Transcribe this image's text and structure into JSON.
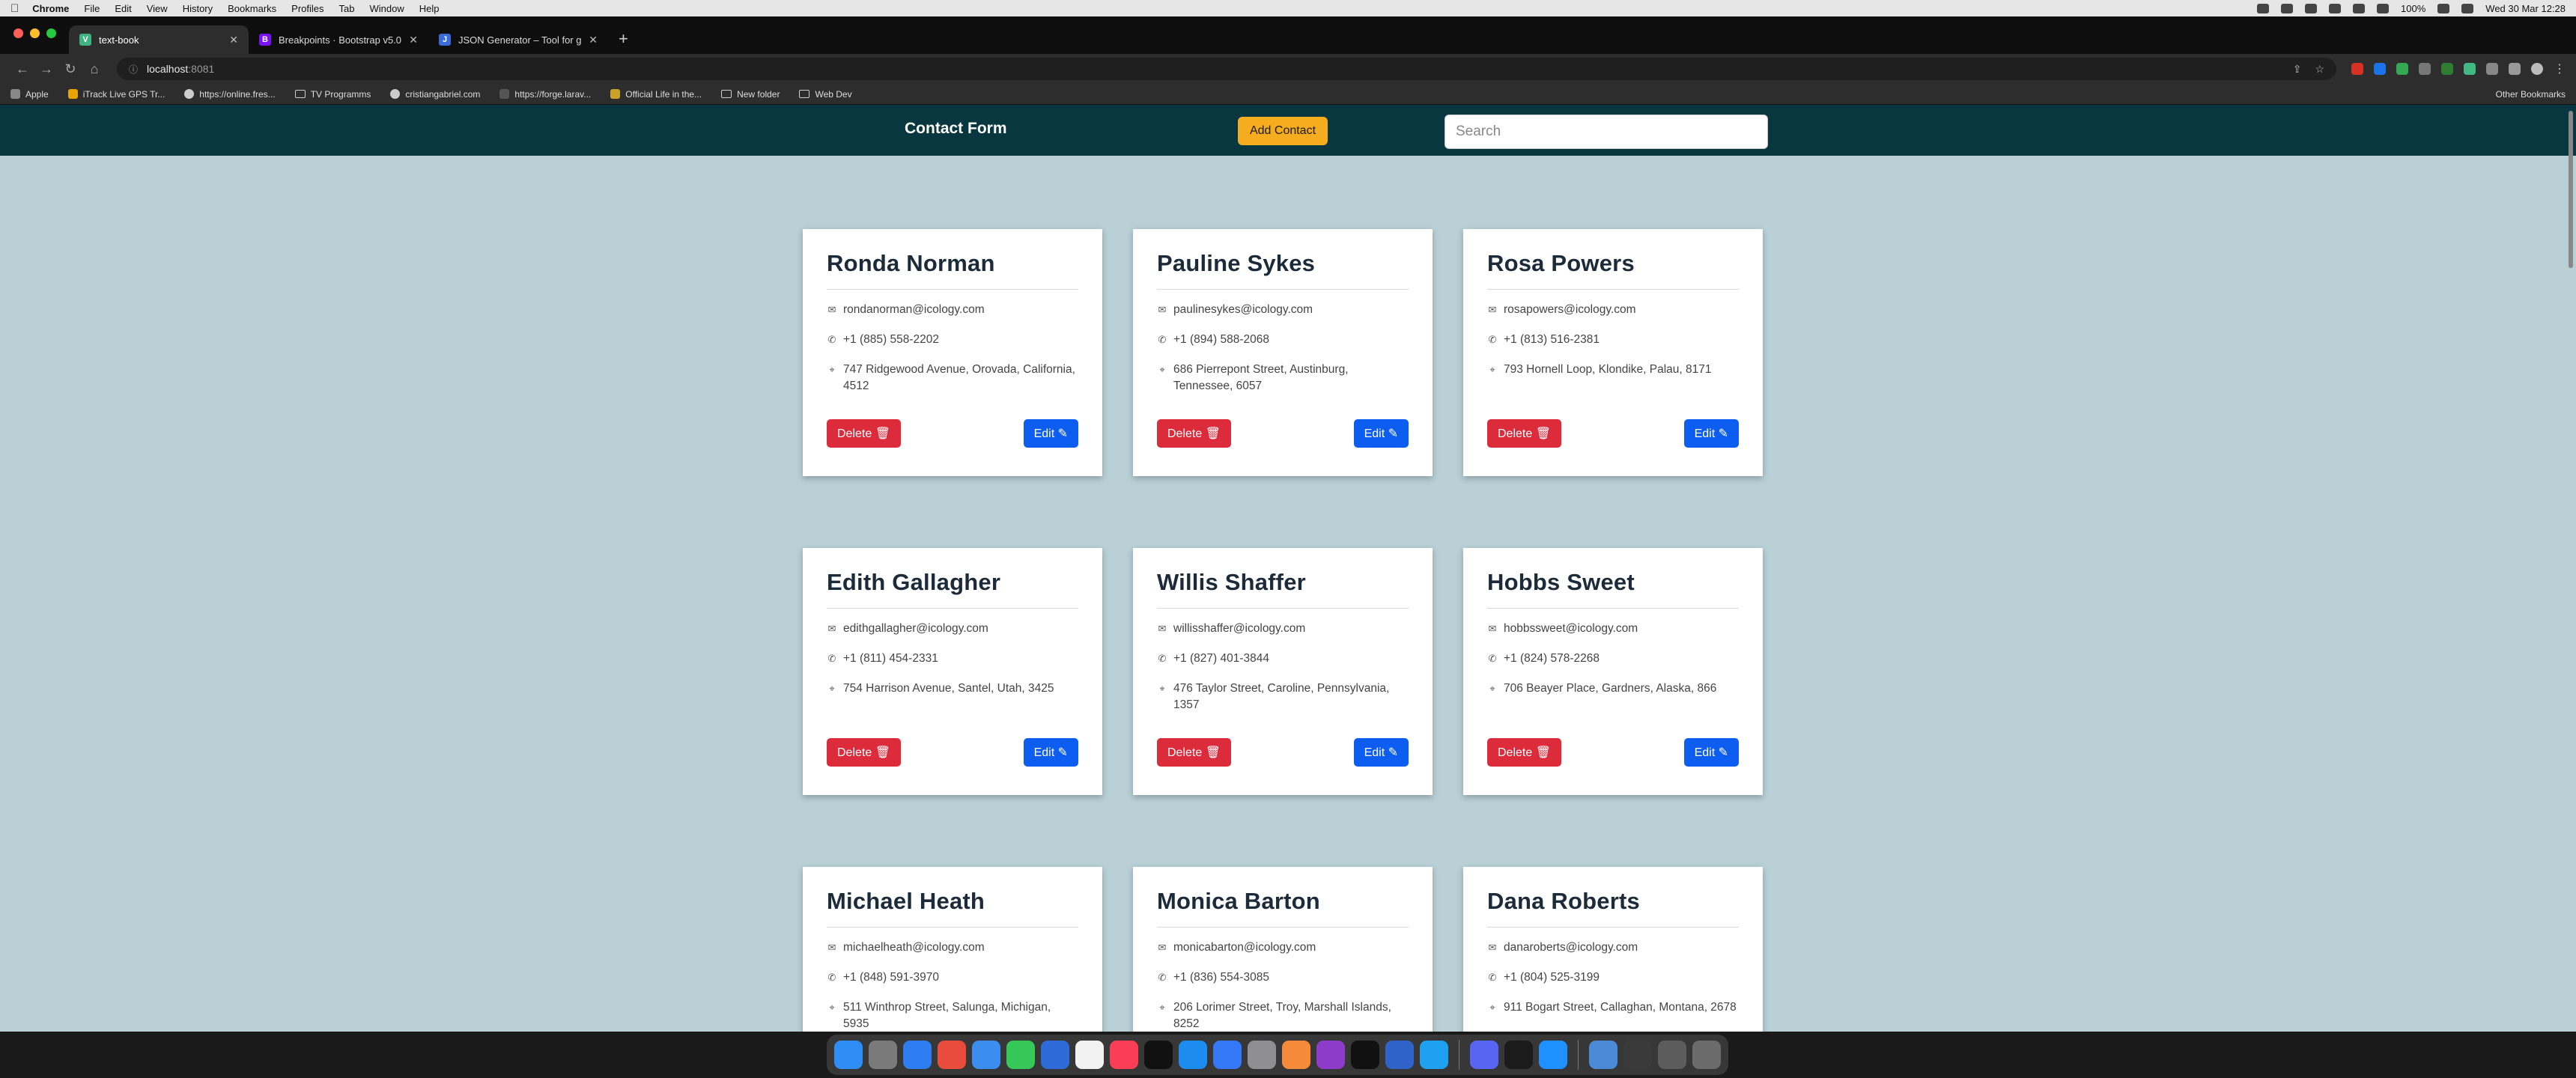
{
  "menubar": {
    "app": "Chrome",
    "items": [
      "File",
      "Edit",
      "View",
      "History",
      "Bookmarks",
      "Profiles",
      "Tab",
      "Window",
      "Help"
    ],
    "battery": "100%",
    "clock": "Wed 30 Mar  12:28"
  },
  "tabs": [
    {
      "title": "text-book",
      "favicon": "V",
      "color": "#3fb27f"
    },
    {
      "title": "Breakpoints · Bootstrap v5.0",
      "favicon": "B",
      "color": "#7a13f1"
    },
    {
      "title": "JSON Generator – Tool for gen",
      "favicon": "J",
      "color": "#3a6bd6"
    }
  ],
  "address": {
    "host": "localhost",
    "port": ":8081"
  },
  "bookmarks": [
    {
      "label": "Apple",
      "icon": "apple-icon"
    },
    {
      "label": "iTrack Live GPS Tr...",
      "icon": "bookmark-icon"
    },
    {
      "label": "https://online.fres...",
      "icon": "globe-icon"
    },
    {
      "label": "TV Programms",
      "icon": "folder-icon"
    },
    {
      "label": "cristiangabriel.com",
      "icon": "globe-icon"
    },
    {
      "label": "https://forge.larav...",
      "icon": "bookmark-icon"
    },
    {
      "label": "Official Life in the...",
      "icon": "bookmark-icon"
    },
    {
      "label": "New folder",
      "icon": "folder-icon"
    },
    {
      "label": "Web Dev",
      "icon": "folder-icon"
    }
  ],
  "bookmarks_right": "Other Bookmarks",
  "app": {
    "brand": "Contact Form",
    "add_label": "Add Contact",
    "search_placeholder": "Search",
    "delete_label": "Delete",
    "edit_label": "Edit"
  },
  "contacts": [
    {
      "name": "Ronda Norman",
      "email": "rondanorman@icology.com",
      "phone": "+1 (885) 558-2202",
      "address": "747 Ridgewood Avenue, Orovada, California, 4512"
    },
    {
      "name": "Pauline Sykes",
      "email": "paulinesykes@icology.com",
      "phone": "+1 (894) 588-2068",
      "address": "686 Pierrepont Street, Austinburg, Tennessee, 6057"
    },
    {
      "name": "Rosa Powers",
      "email": "rosapowers@icology.com",
      "phone": "+1 (813) 516-2381",
      "address": "793 Hornell Loop, Klondike, Palau, 8171"
    },
    {
      "name": "Edith Gallagher",
      "email": "edithgallagher@icology.com",
      "phone": "+1 (811) 454-2331",
      "address": "754 Harrison Avenue, Santel, Utah, 3425"
    },
    {
      "name": "Willis Shaffer",
      "email": "willisshaffer@icology.com",
      "phone": "+1 (827) 401-3844",
      "address": "476 Taylor Street, Caroline, Pennsylvania, 1357"
    },
    {
      "name": "Hobbs Sweet",
      "email": "hobbssweet@icology.com",
      "phone": "+1 (824) 578-2268",
      "address": "706 Beayer Place, Gardners, Alaska, 866"
    },
    {
      "name": "Michael Heath",
      "email": "michaelheath@icology.com",
      "phone": "+1 (848) 591-3970",
      "address": "511 Winthrop Street, Salunga, Michigan, 5935"
    },
    {
      "name": "Monica Barton",
      "email": "monicabarton@icology.com",
      "phone": "+1 (836) 554-3085",
      "address": "206 Lorimer Street, Troy, Marshall Islands, 8252"
    },
    {
      "name": "Dana Roberts",
      "email": "danaroberts@icology.com",
      "phone": "+1 (804) 525-3199",
      "address": "911 Bogart Street, Callaghan, Montana, 2678"
    }
  ],
  "dock_colors": [
    "#2f8ef5",
    "#7a7a7a",
    "#2d7cf0",
    "#e94b3c",
    "#3b8ef0",
    "#36c759",
    "#2f6bd8",
    "#f2f2f2",
    "#fa3e56",
    "#111111",
    "#1d8cf0",
    "#3478f6",
    "#8e8e93",
    "#f58a3b",
    "#8d3cc9",
    "#111111",
    "#2f63c9",
    "#1ea1f1",
    "#5865f2",
    "#1b1b1b",
    "#1e90ff",
    "#4a8ad7",
    "#3a3a3a",
    "#5c5c5c",
    "#6b6b6b"
  ]
}
